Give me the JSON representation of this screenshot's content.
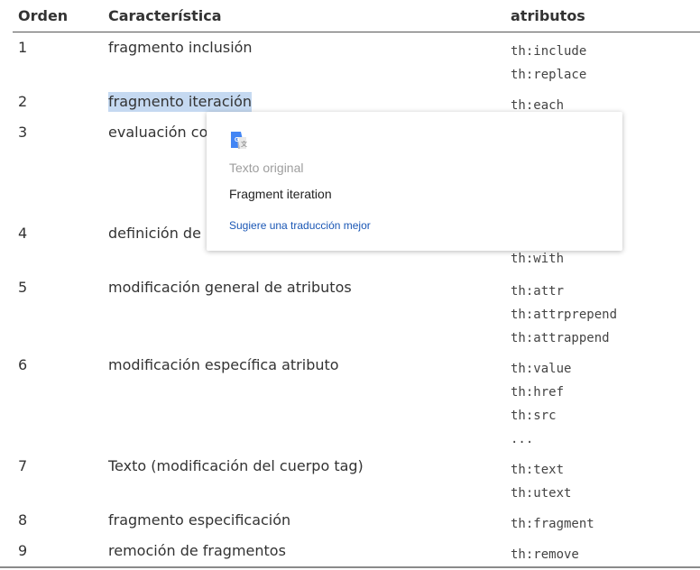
{
  "table": {
    "headers": {
      "order": "Orden",
      "feature": "Característica",
      "attributes": "atributos"
    },
    "rows": [
      {
        "order": "1",
        "feature": "fragmento inclusión",
        "attrs": [
          "th:include",
          "th:replace"
        ]
      },
      {
        "order": "2",
        "feature": "fragmento iteración",
        "attrs": [
          "th:each"
        ]
      },
      {
        "order": "3",
        "feature": "evaluación co",
        "attrs": []
      },
      {
        "order": "4",
        "feature": "definición de",
        "attrs": [
          "th:with"
        ]
      },
      {
        "order": "5",
        "feature": "modificación general de atributos",
        "attrs": [
          "th:attr",
          "th:attrprepend",
          "th:attrappend"
        ]
      },
      {
        "order": "6",
        "feature": "modificación específica atributo",
        "attrs": [
          "th:value",
          "th:href",
          "th:src",
          "..."
        ]
      },
      {
        "order": "7",
        "feature": "Texto (modificación del cuerpo tag)",
        "attrs": [
          "th:text",
          "th:utext"
        ]
      },
      {
        "order": "8",
        "feature": "fragmento especificación",
        "attrs": [
          "th:fragment"
        ]
      },
      {
        "order": "9",
        "feature": "remoción de fragmentos",
        "attrs": [
          "th:remove"
        ]
      }
    ]
  },
  "translate_popup": {
    "icon": "google-translate-icon",
    "original_label": "Texto original",
    "translation": "Fragment iteration",
    "suggest_link": "Sugiere una traducción mejor"
  },
  "colors": {
    "selection": "#c5d9f1",
    "link": "#1a57b5"
  }
}
